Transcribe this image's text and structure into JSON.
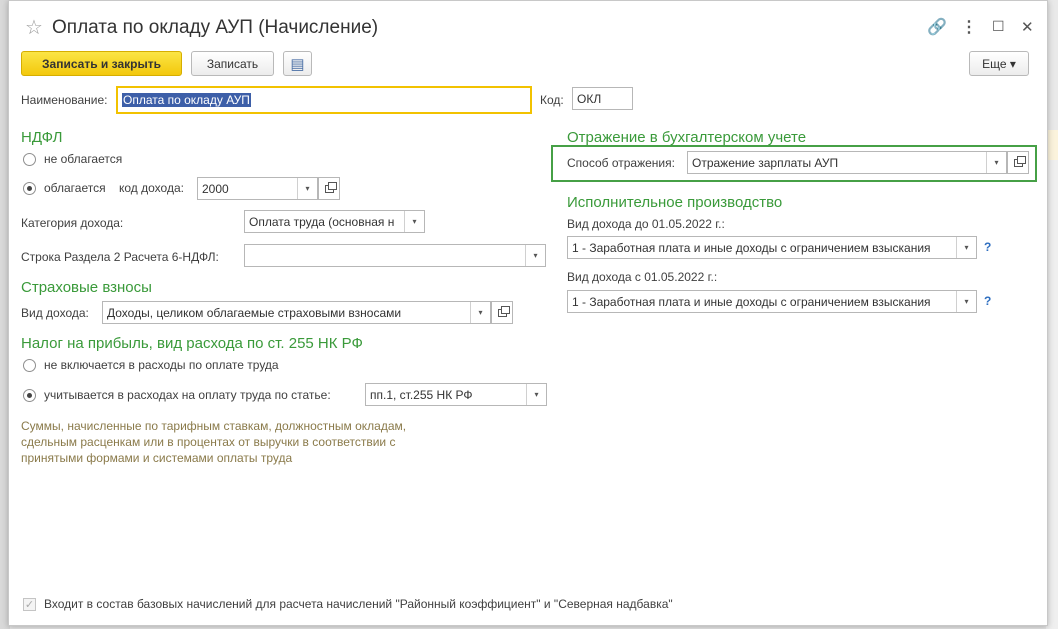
{
  "window": {
    "title": "Оплата по окладу АУП (Начисление)",
    "favorite_icon": "☆",
    "link_icon": "🔗",
    "more_icon": "⋮",
    "maximize_icon": "☐",
    "close_icon": "✕"
  },
  "toolbar": {
    "save_close_label": "Записать и закрыть",
    "save_label": "Записать",
    "more_label": "Еще ▾",
    "report_icon": "▤"
  },
  "fields": {
    "name_label": "Наименование:",
    "name_value": "Оплата по окладу АУП",
    "code_label": "Код:",
    "code_value": "ОКЛ"
  },
  "ndfl": {
    "section_title": "НДФЛ",
    "option_not_taxed": "не облагается",
    "option_taxed": "облагается",
    "income_code_label": "код дохода:",
    "income_code_value": "2000",
    "income_category_label": "Категория дохода:",
    "income_category_value": "Оплата труда (основная н",
    "section2_label": "Строка Раздела 2 Расчета 6-НДФЛ:",
    "section2_value": ""
  },
  "insurance": {
    "section_title": "Страховые взносы",
    "income_type_label": "Вид дохода:",
    "income_type_value": "Доходы, целиком облагаемые страховыми взносами"
  },
  "profit_tax": {
    "section_title": "Налог на прибыль, вид расхода по ст. 255 НК РФ",
    "option_not_included": "не включается в расходы по оплате труда",
    "option_included": "учитывается в расходах на оплату труда по статье:",
    "article_value": "пп.1, ст.255 НК РФ",
    "note": "Суммы, начисленные по тарифным ставкам, должностным окладам, сдельным расценкам или в процентах от выручки в соответствии с принятыми формами и системами оплаты труда"
  },
  "accounting": {
    "section_title": "Отражение в бухгалтерском учете",
    "method_label": "Способ отражения:",
    "method_value": "Отражение зарплаты АУП"
  },
  "enforcement": {
    "section_title": "Исполнительное производство",
    "before_label": "Вид дохода до 01.05.2022 г.:",
    "before_value": "1 - Заработная плата и иные доходы с ограничением взыскания",
    "after_label": "Вид дохода с 01.05.2022 г.:",
    "after_value": "1 - Заработная плата и иные доходы с ограничением взыскания",
    "help": "?"
  },
  "footer": {
    "base_checkbox_label": "Входит в состав базовых начислений для расчета начислений \"Районный коэффициент\" и \"Северная надбавка\"",
    "check_mark": "✓"
  },
  "glyphs": {
    "dropdown": "▾"
  }
}
